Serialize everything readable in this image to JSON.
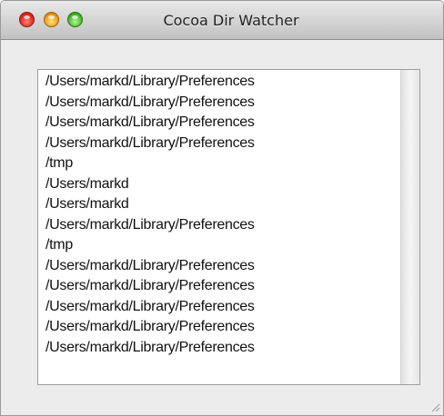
{
  "window": {
    "title": "Cocoa Dir Watcher"
  },
  "colors": {
    "close": "#e52b1f",
    "minimize": "#f0a21c",
    "zoom": "#4fbf2e",
    "window_background": "#ececec",
    "list_background": "#ffffff"
  },
  "icons": {
    "close": "close-icon",
    "minimize": "minimize-icon",
    "zoom": "zoom-icon",
    "resize": "resize-grip-icon"
  },
  "log": {
    "lines": [
      "/Users/markd/Library/Preferences",
      "/Users/markd/Library/Preferences",
      "/Users/markd/Library/Preferences",
      "/Users/markd/Library/Preferences",
      "/tmp",
      "/Users/markd",
      "/Users/markd",
      "/Users/markd/Library/Preferences",
      "/tmp",
      "/Users/markd/Library/Preferences",
      "/Users/markd/Library/Preferences",
      "/Users/markd/Library/Preferences",
      "/Users/markd/Library/Preferences",
      "/Users/markd/Library/Preferences"
    ]
  }
}
